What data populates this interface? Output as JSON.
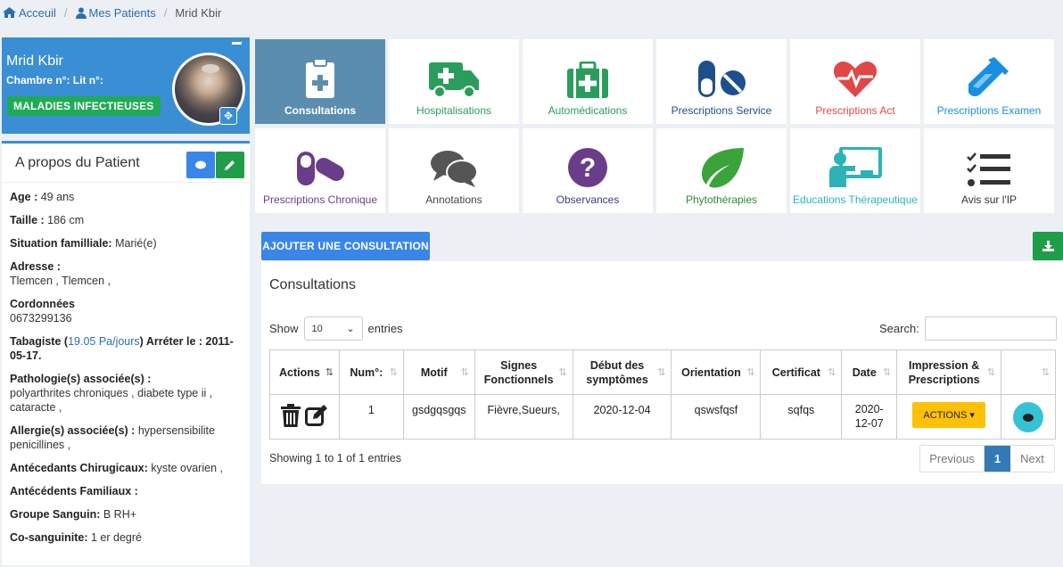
{
  "breadcrumb": {
    "home": "Acceuil",
    "patients": "Mes Patients",
    "current": "Mrid Kbir"
  },
  "patient": {
    "name": "Mrid Kbir",
    "room": "Chambre n°: Lit n°:",
    "service": "MALADIES INFECTIEUSES"
  },
  "about": {
    "title": "A propos du Patient",
    "age_label": "Age :",
    "age": "49 ans",
    "height_label": "Taille :",
    "height": "186 cm",
    "family_label": "Situation familliale:",
    "family": "Marié(e)",
    "address_label": "Adresse :",
    "address": "Tlemcen , Tlemcen ,",
    "contact_label": "Cordonnées",
    "contact": "0673299136",
    "smoker_label": "Tabagiste (",
    "smoker_value": "19.05 Pa/jours",
    "smoker_rest": ") Arréter le : 2011-05-17.",
    "pathology_label": "Pathologie(s) associée(s) :",
    "pathology": "polyarthrites chroniques , diabete type ii , cataracte ,",
    "allergy_label": "Allergie(s) associée(s) :",
    "allergy": "hypersensibilite penicillines ,",
    "surgical_label": "Antécedants Chirugicaux:",
    "surgical": "kyste ovarien ,",
    "family_hist_label": "Antécédents Familiaux :",
    "blood_label": "Groupe Sanguin:",
    "blood": "B RH+",
    "consang_label": "Co-sanguinite:",
    "consang": "1 er degré"
  },
  "tiles": [
    {
      "label": "Consultations",
      "icon": "clipboard-plus-icon",
      "color": "#5b8db1"
    },
    {
      "label": "Hospitalisations",
      "icon": "ambulance-icon",
      "color": "#2a9d5c"
    },
    {
      "label": "Automédications",
      "icon": "medkit-icon",
      "color": "#2a9d5c"
    },
    {
      "label": "Prescriptions Service",
      "icon": "pills-icon",
      "color": "#1e4f8c"
    },
    {
      "label": "Prescriptions Act",
      "icon": "heartbeat-icon",
      "color": "#e04848"
    },
    {
      "label": "Prescriptions Examen",
      "icon": "test-tube-icon",
      "color": "#1a8fe0"
    },
    {
      "label": "Prescriptions Chronique",
      "icon": "capsules-icon",
      "color": "#6a3d8a"
    },
    {
      "label": "Annotations",
      "icon": "comments-icon",
      "color": "#444444"
    },
    {
      "label": "Observances",
      "icon": "question-icon",
      "color": "#3a3a8a"
    },
    {
      "label": "Phytothérapies",
      "icon": "leaf-icon",
      "color": "#2e8b2e"
    },
    {
      "label": "Educations Thérapeutique",
      "icon": "teacher-icon",
      "color": "#2bb3b8"
    },
    {
      "label": "Avis sur l'IP",
      "icon": "tasks-icon",
      "color": "#333333"
    }
  ],
  "toolbar": {
    "add_consultation": "AJOUTER UNE CONSULTATION"
  },
  "consultations": {
    "title": "Consultations",
    "show_label": "Show",
    "page_size": "10",
    "entries_label": "entries",
    "search_label": "Search:",
    "columns": [
      "Actions",
      "Num°:",
      "Motif",
      "Signes Fonctionnels",
      "Début des symptômes",
      "Orientation",
      "Certificat",
      "Date",
      "Impression & Prescriptions",
      ""
    ],
    "rows": [
      {
        "num": "1",
        "motif": "gsdgqsgqs",
        "signes": "Fièvre,Sueurs,",
        "debut": "2020-12-04",
        "orientation": "qswsfqsf",
        "certificat": "sqfqs",
        "date": "2020-12-07",
        "actions_btn": "ACTIONS ▾"
      }
    ],
    "footer": "Showing 1 to 1 of 1 entries",
    "pager": {
      "previous": "Previous",
      "current": "1",
      "next": "Next"
    }
  }
}
